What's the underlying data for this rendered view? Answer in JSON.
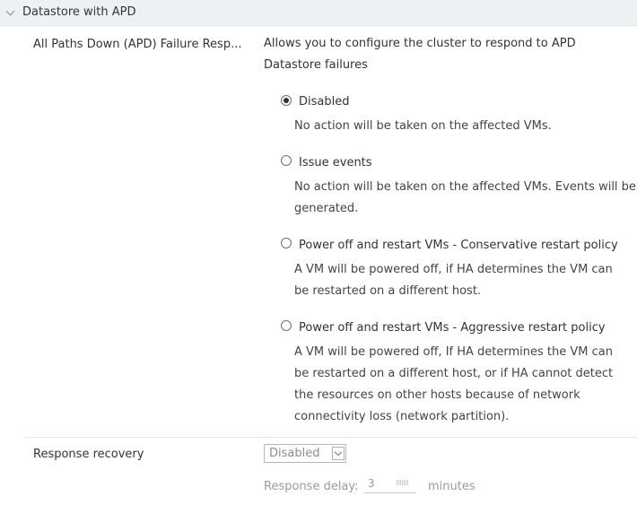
{
  "section": {
    "title": "Datastore with APD"
  },
  "apd": {
    "label": "All Paths Down (APD) Failure Resp...",
    "description_line1": "Allows you to configure the cluster to respond to APD",
    "description_line2": "Datastore failures",
    "options": [
      {
        "label": "Disabled",
        "selected": true,
        "desc": [
          "No action will be taken on the affected VMs."
        ]
      },
      {
        "label": "Issue events",
        "selected": false,
        "desc": [
          "No action will be taken on the affected VMs. Events will be",
          "generated."
        ]
      },
      {
        "label": "Power off and restart VMs - Conservative restart policy",
        "selected": false,
        "desc": [
          "A VM will be powered off, if HA determines the VM can",
          "be restarted on a different host."
        ]
      },
      {
        "label": "Power off and restart VMs - Aggressive restart policy",
        "selected": false,
        "desc": [
          "A VM will be powered off, If HA determines the VM can",
          "be restarted on a different host, or if HA cannot detect",
          "the resources on other hosts because of network",
          "connectivity loss (network partition)."
        ]
      }
    ]
  },
  "recovery": {
    "label": "Response recovery",
    "select_value": "Disabled",
    "delay_label": "Response delay:",
    "delay_value": "3",
    "delay_unit": "minutes"
  }
}
